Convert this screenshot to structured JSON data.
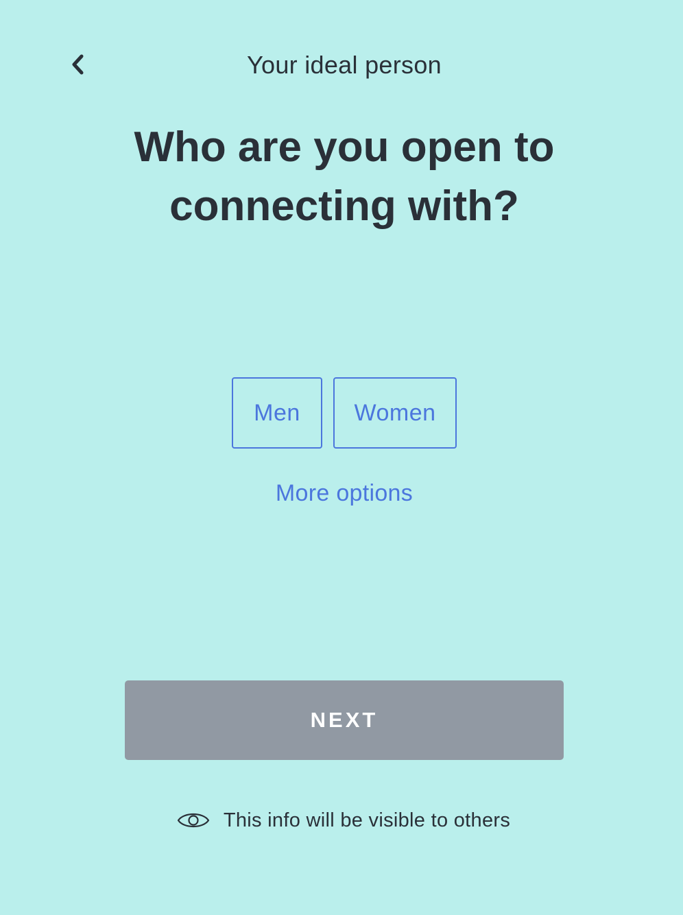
{
  "header": {
    "back_icon": "chevron-left-icon",
    "title": "Your ideal person"
  },
  "question": {
    "line1": "Who are you open to",
    "line2": "connecting with?"
  },
  "options": [
    {
      "label": "Men",
      "selected": false
    },
    {
      "label": "Women",
      "selected": false
    }
  ],
  "more_options_label": "More options",
  "next_label": "NEXT",
  "visibility_note": {
    "icon": "eye-icon",
    "text": "This info will be visible to others"
  },
  "colors": {
    "background": "#baefec",
    "text": "#2a3038",
    "accent": "#4b76dd",
    "next_button_disabled": "#9199a3"
  }
}
